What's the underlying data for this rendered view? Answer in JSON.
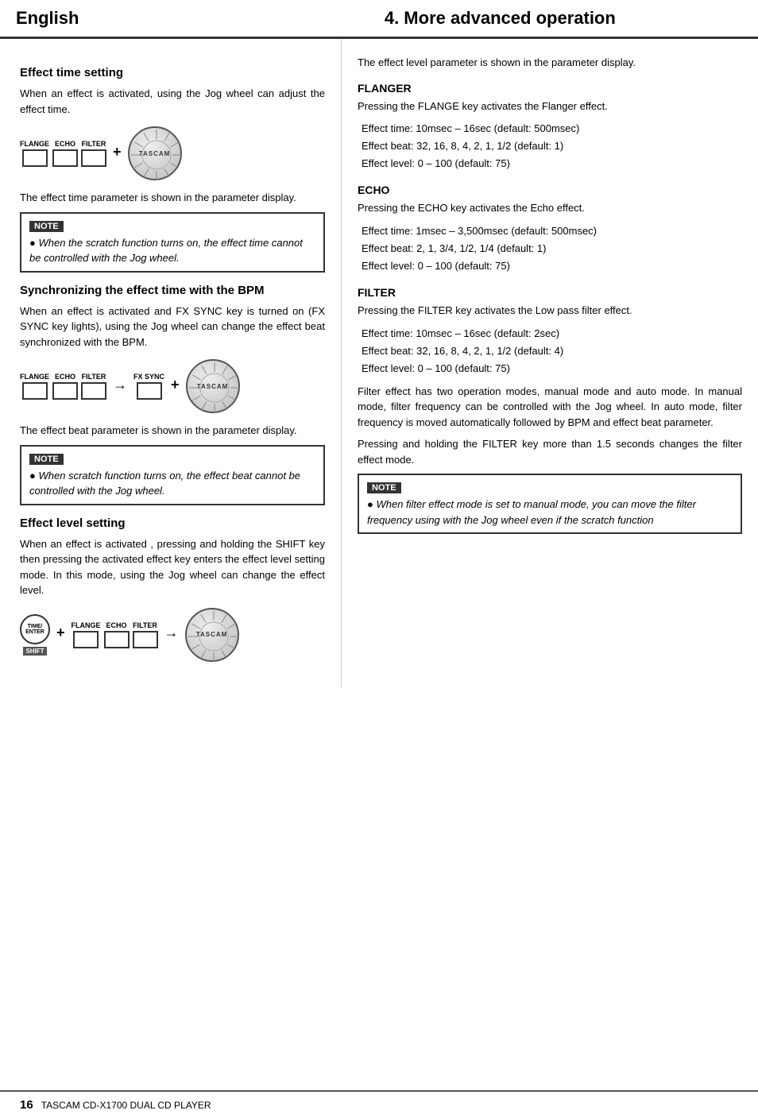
{
  "header": {
    "english_label": "English",
    "title": "4. More advanced operation"
  },
  "left": {
    "section1": {
      "heading": "Effect time setting",
      "para1": "When an effect is activated, using the Jog wheel can adjust the effect time.",
      "para2": "The effect time parameter is shown in the parameter display.",
      "note_label": "NOTE",
      "note_text": "When the scratch function  turns on, the effect time cannot be controlled with the Jog wheel."
    },
    "section2": {
      "heading": "Synchronizing the effect time with the BPM",
      "para1": "When an effect is activated and FX SYNC key is turned on (FX SYNC key lights), using the Jog wheel can change the effect beat synchronized with the BPM.",
      "para2": "The effect beat parameter is shown in the parameter display.",
      "note_label": "NOTE",
      "note_text": "When scratch function  turns on, the effect beat cannot be controlled with the Jog wheel."
    },
    "section3": {
      "heading": "Effect level setting",
      "para1": "When an effect is activated ,  pressing and holding the SHIFT key then pressing the activated effect key enters the effect level setting mode.  In this mode, using the Jog wheel can change the effect level."
    }
  },
  "right": {
    "intro": "The effect level parameter is shown in the parameter display.",
    "flanger": {
      "heading": "FLANGER",
      "intro": "Pressing the FLANGE key activates the Flanger effect.",
      "time": "Effect time:  10msec – 16sec (default: 500msec)",
      "beat": "Effect beat:  32, 16, 8, 4, 2, 1, 1/2 (default: 1)",
      "level": "Effect level:  0 – 100 (default: 75)"
    },
    "echo": {
      "heading": "ECHO",
      "intro": "Pressing the ECHO key activates the Echo effect.",
      "time": "Effect time:  1msec  –   3,500msec  (default: 500msec)",
      "beat": "Effect beat:  2, 1, 3/4, 1/2, 1/4 (default: 1)",
      "level": "Effect level:  0 – 100 (default: 75)"
    },
    "filter": {
      "heading": "FILTER",
      "intro": "Pressing the FILTER key activates the Low pass filter effect.",
      "time": "Effect time:  10msec – 16sec (default: 2sec)",
      "beat": "Effect beat:  32, 16, 8, 4, 2, 1, 1/2 (default: 4)",
      "level": "Effect level:  0 – 100 (default: 75)",
      "para1": "Filter effect has two operation modes, manual mode and auto mode.  In manual mode, filter frequency can be  controlled with the Jog wheel.  In auto mode, filter frequency is moved automatically followed by BPM and effect beat parameter.",
      "para2": "Pressing and holding the FILTER key more than 1.5 seconds changes the filter effect mode.",
      "note_label": "NOTE",
      "note_text": "When filter effect mode is set to manual mode, you can move the filter frequency using with the Jog wheel even if the scratch function"
    }
  },
  "footer": {
    "page": "16",
    "product": "TASCAM  CD-X1700  DUAL CD PLAYER"
  },
  "buttons": {
    "flange": "FLANGE",
    "echo": "ECHO",
    "filter": "FILTER",
    "fx_sync": "FX SYNC",
    "time_enter_line1": "TIME/",
    "time_enter_line2": "ENTER",
    "shift": "SHIFT",
    "tascam": "TASCAM"
  }
}
